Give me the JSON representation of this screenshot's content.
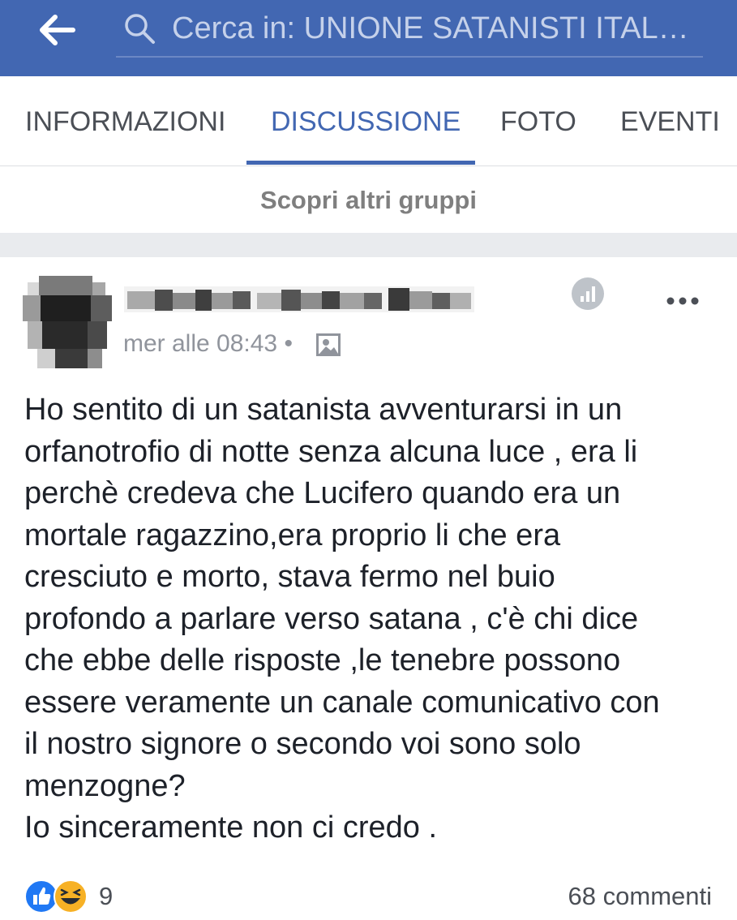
{
  "header": {
    "search_text": "Cerca in: UNIONE SATANISTI ITAL…"
  },
  "tabs": [
    {
      "label": "INFORMAZIONI",
      "active": false
    },
    {
      "label": "DISCUSSIONE",
      "active": true
    },
    {
      "label": "FOTO",
      "active": false
    },
    {
      "label": "EVENTI",
      "active": false
    }
  ],
  "discover": {
    "label": "Scopri altri gruppi"
  },
  "post": {
    "time": "mer alle 08:43 •",
    "body": "Ho sentito di un satanista avventurarsi in un\norfanotrofio di notte senza alcuna luce , era li\nperchè credeva che Lucifero quando era un\nmortale ragazzino,era proprio li che era\ncresciuto e morto, stava fermo nel buio\nprofondo a parlare verso satana , c'è chi dice\nche ebbe delle risposte ,le tenebre  possono\nessere veramente un canale comunicativo con\nil nostro signore o secondo voi sono solo\nmenzogne?\nIo sinceramente non ci credo .",
    "reaction_count": "9",
    "comments": "68 commenti"
  },
  "colors": {
    "brand": "#4267b2",
    "like": "#2078f4",
    "haha": "#f7b125"
  },
  "icons": [
    "back-arrow-icon",
    "search-icon",
    "stats-icon",
    "more-options-icon",
    "photo-icon",
    "like-reaction-icon",
    "haha-reaction-icon"
  ]
}
